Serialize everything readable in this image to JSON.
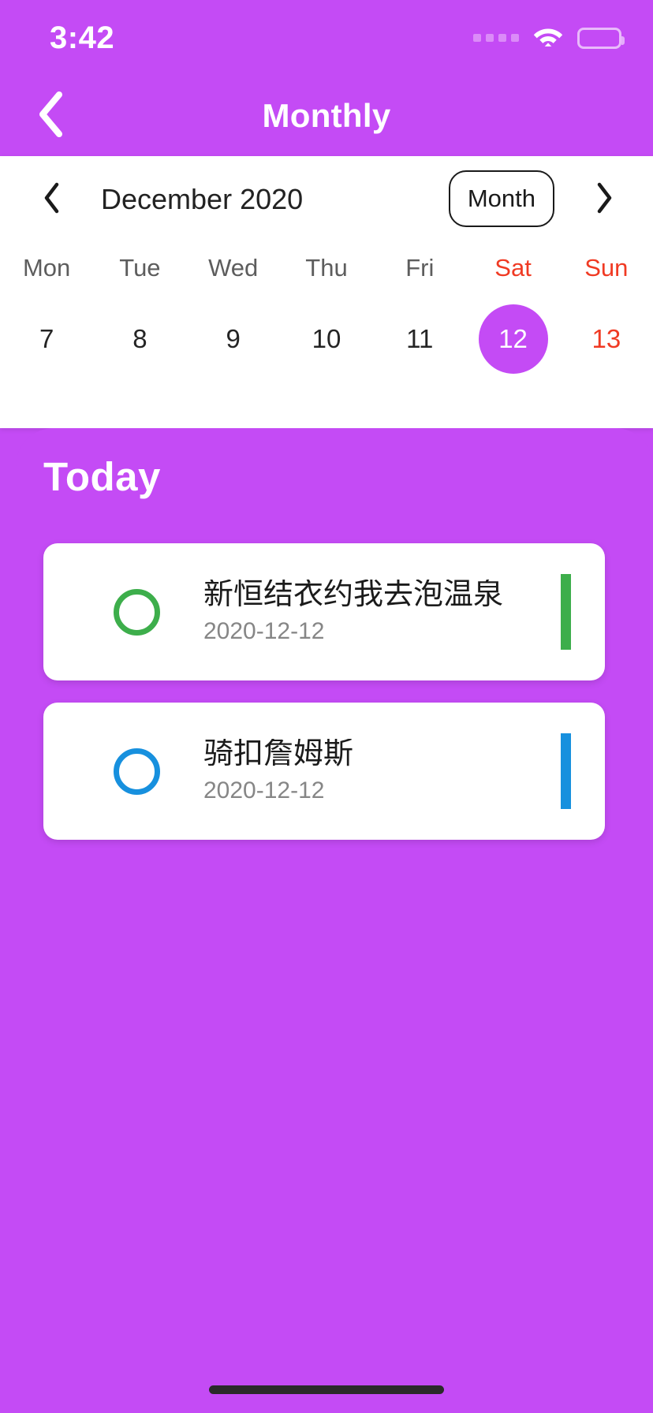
{
  "theme": {
    "accent_purple": "#C44BF5",
    "weekend_red": "#F03A23",
    "card_white": "#FFFFFF",
    "green": "#3DAE4B",
    "blue": "#1790DE"
  },
  "status_bar": {
    "time": "3:42",
    "signal_icon": "signal-dots-icon",
    "wifi_icon": "wifi-icon",
    "battery_icon": "battery-icon"
  },
  "nav_bar": {
    "title": "Monthly",
    "back_icon": "chevron-left-icon"
  },
  "calendar": {
    "month_label": "December 2020",
    "prev_icon": "chevron-left-icon",
    "next_icon": "chevron-right-icon",
    "view_toggle_label": "Month",
    "weekdays": [
      {
        "label": "Mon",
        "weekend": false
      },
      {
        "label": "Tue",
        "weekend": false
      },
      {
        "label": "Wed",
        "weekend": false
      },
      {
        "label": "Thu",
        "weekend": false
      },
      {
        "label": "Fri",
        "weekend": false
      },
      {
        "label": "Sat",
        "weekend": true
      },
      {
        "label": "Sun",
        "weekend": true
      }
    ],
    "days": [
      {
        "number": "7",
        "weekend": false,
        "selected": false
      },
      {
        "number": "8",
        "weekend": false,
        "selected": false
      },
      {
        "number": "9",
        "weekend": false,
        "selected": false
      },
      {
        "number": "10",
        "weekend": false,
        "selected": false
      },
      {
        "number": "11",
        "weekend": false,
        "selected": false
      },
      {
        "number": "12",
        "weekend": true,
        "selected": true
      },
      {
        "number": "13",
        "weekend": true,
        "selected": false
      }
    ]
  },
  "today_sheet": {
    "title": "Today",
    "events": [
      {
        "title": "新恒结衣约我去泡温泉",
        "date": "2020-12-12",
        "color": "#3DAE4B",
        "check_icon": "circle-outline-icon",
        "completed": false
      },
      {
        "title": "骑扣詹姆斯",
        "date": "2020-12-12",
        "color": "#1790DE",
        "check_icon": "circle-outline-icon",
        "completed": false
      }
    ]
  }
}
